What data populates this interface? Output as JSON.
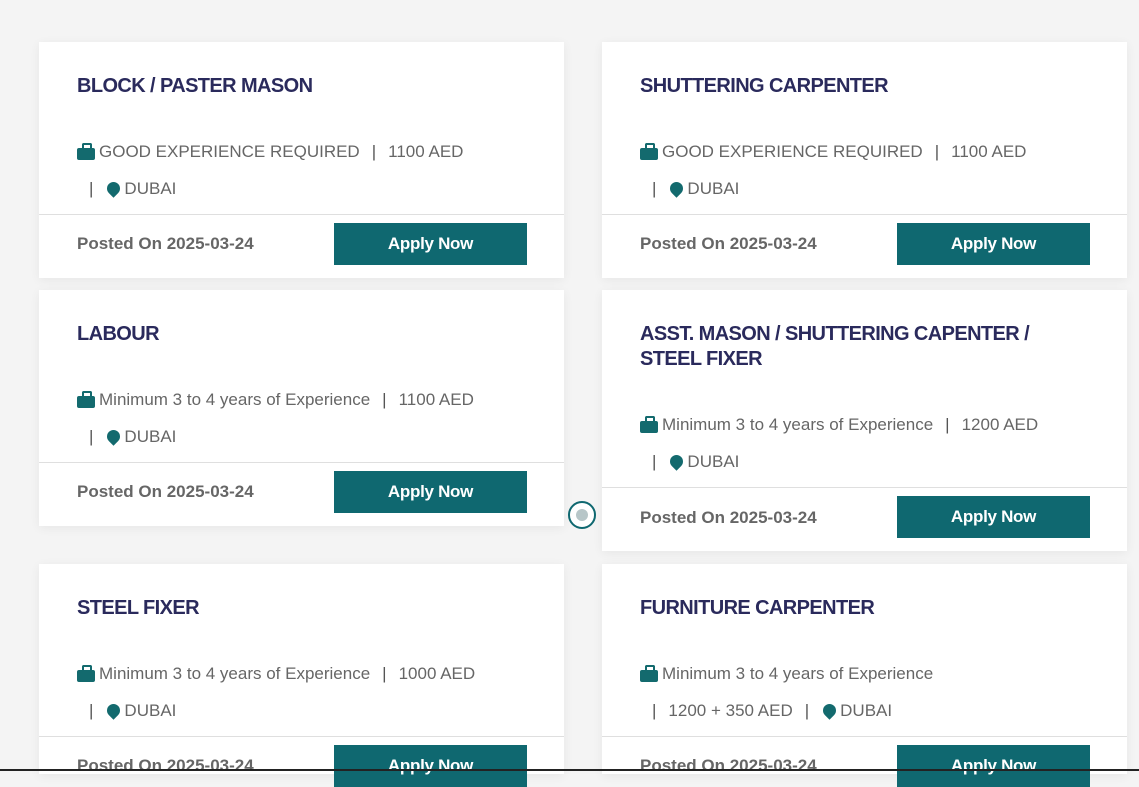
{
  "jobs": [
    {
      "title": "BLOCK / PASTER MASON",
      "experience": "GOOD EXPERIENCE REQUIRED",
      "salary": "1100 AED",
      "location": "DUBAI",
      "posted": "Posted On 2025-03-24",
      "apply": "Apply Now"
    },
    {
      "title": "SHUTTERING CARPENTER",
      "experience": "GOOD EXPERIENCE REQUIRED",
      "salary": "1100 AED",
      "location": "DUBAI",
      "posted": "Posted On 2025-03-24",
      "apply": "Apply Now"
    },
    {
      "title": "LABOUR",
      "experience": "Minimum 3 to 4 years of Experience",
      "salary": "1100 AED",
      "location": "DUBAI",
      "posted": "Posted On 2025-03-24",
      "apply": "Apply Now"
    },
    {
      "title": "ASST. MASON / SHUTTERING CAPENTER / STEEL FIXER",
      "experience": "Minimum 3 to 4 years of Experience",
      "salary": "1200 AED",
      "location": "DUBAI",
      "posted": "Posted On 2025-03-24",
      "apply": "Apply Now"
    },
    {
      "title": "STEEL FIXER",
      "experience": "Minimum 3 to 4 years of Experience",
      "salary": "1000 AED",
      "location": "DUBAI",
      "posted": "Posted On 2025-03-24",
      "apply": "Apply Now"
    },
    {
      "title": "FURNITURE CARPENTER",
      "experience": "Minimum 3 to 4 years of Experience",
      "salary": "1200 + 350 AED",
      "location": "DUBAI",
      "posted": "Posted On 2025-03-24",
      "apply": "Apply Now"
    }
  ],
  "separator": "|",
  "colors": {
    "accent": "#0f6870",
    "title": "#2a2a5c",
    "text": "#666666"
  }
}
